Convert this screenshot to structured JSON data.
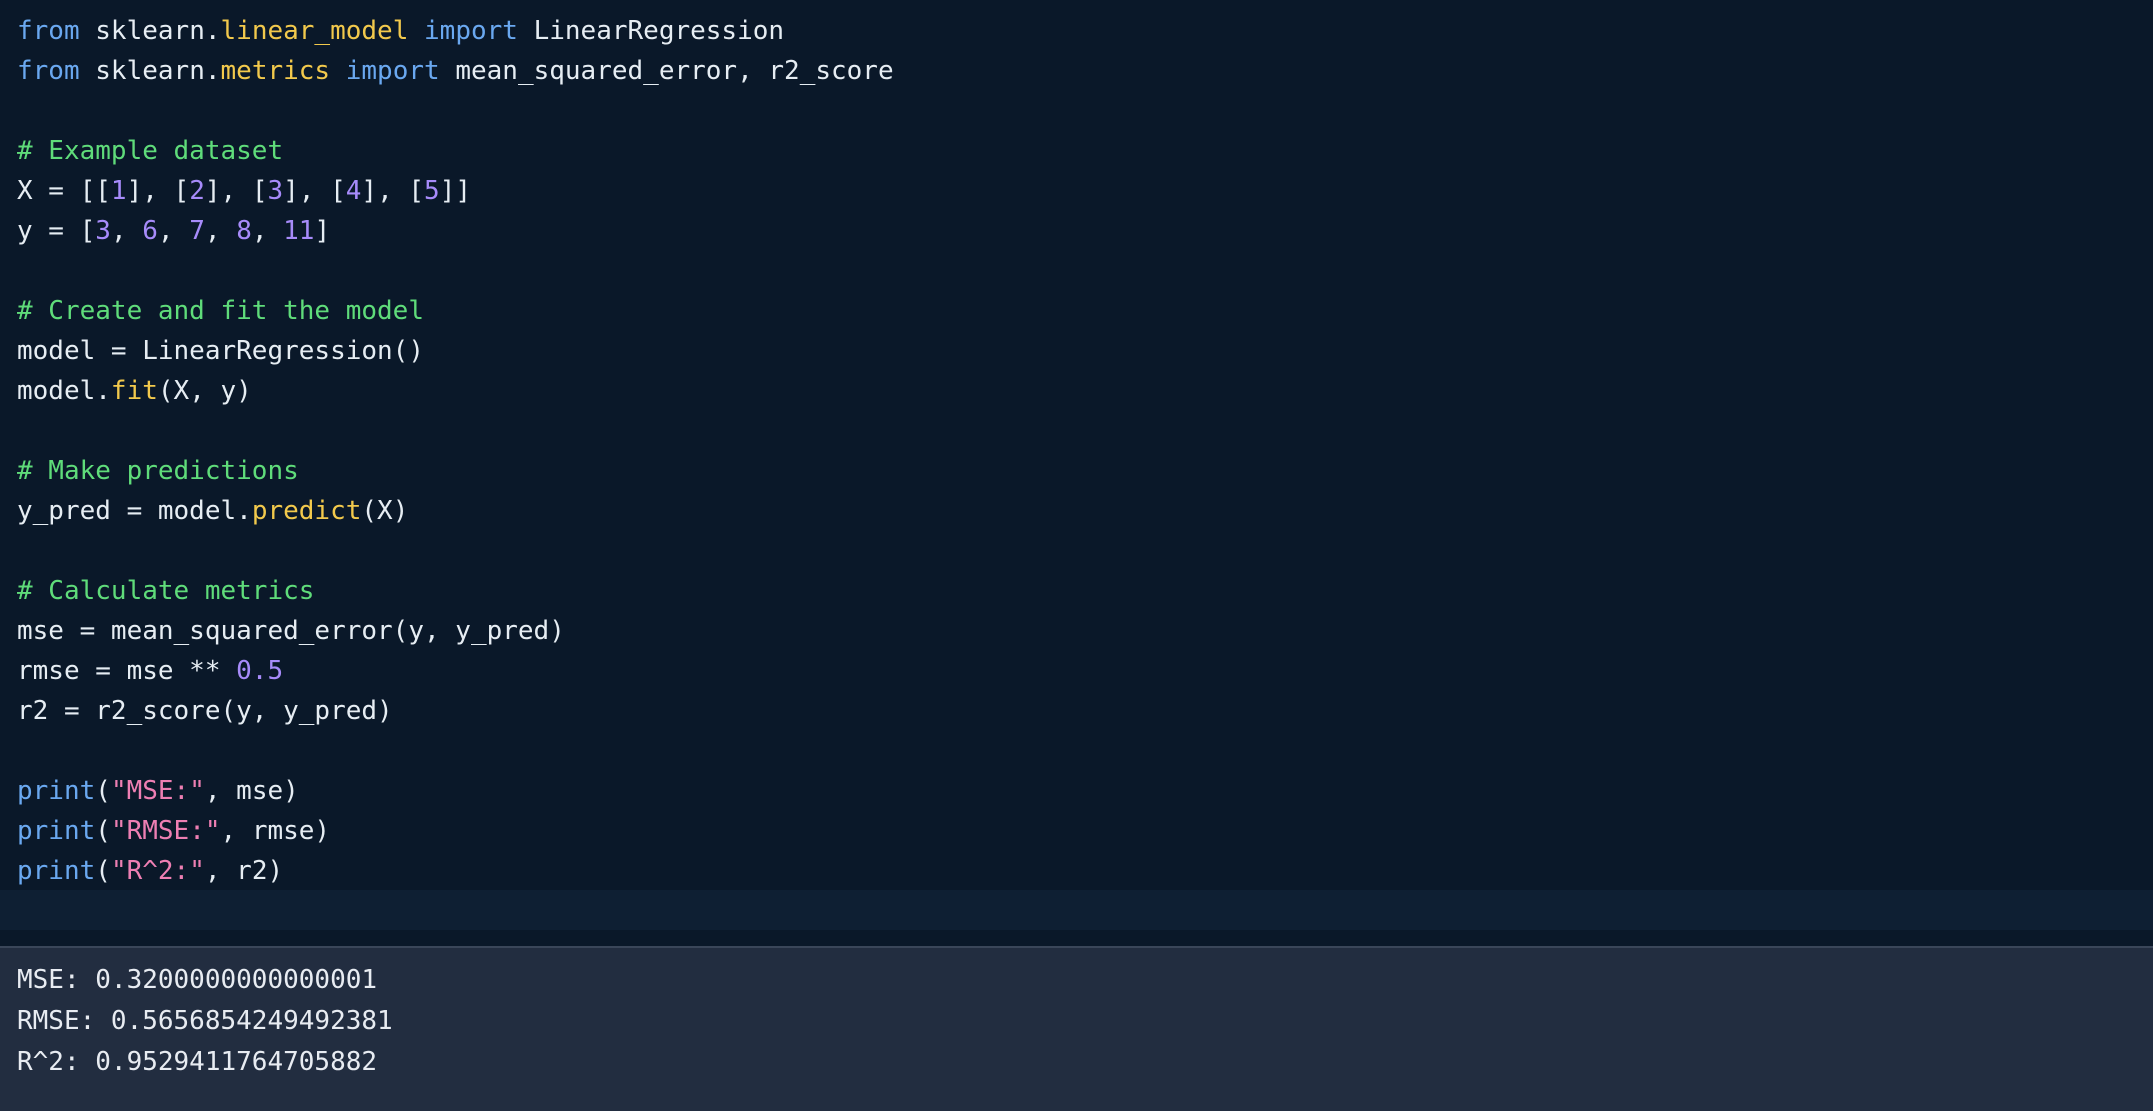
{
  "editor": {
    "lines": [
      [
        [
          "kw",
          "from"
        ],
        [
          "plain",
          " sklearn."
        ],
        [
          "fn",
          "linear_model"
        ],
        [
          "plain",
          " "
        ],
        [
          "kw",
          "import"
        ],
        [
          "plain",
          " LinearRegression"
        ]
      ],
      [
        [
          "kw",
          "from"
        ],
        [
          "plain",
          " sklearn."
        ],
        [
          "fn",
          "metrics"
        ],
        [
          "plain",
          " "
        ],
        [
          "kw",
          "import"
        ],
        [
          "plain",
          " mean_squared_error, r2_score"
        ]
      ],
      [],
      [
        [
          "cm",
          "# Example dataset"
        ]
      ],
      [
        [
          "plain",
          "X = [["
        ],
        [
          "num",
          "1"
        ],
        [
          "plain",
          "], ["
        ],
        [
          "num",
          "2"
        ],
        [
          "plain",
          "], ["
        ],
        [
          "num",
          "3"
        ],
        [
          "plain",
          "], ["
        ],
        [
          "num",
          "4"
        ],
        [
          "plain",
          "], ["
        ],
        [
          "num",
          "5"
        ],
        [
          "plain",
          "]]"
        ]
      ],
      [
        [
          "plain",
          "y = ["
        ],
        [
          "num",
          "3"
        ],
        [
          "plain",
          ", "
        ],
        [
          "num",
          "6"
        ],
        [
          "plain",
          ", "
        ],
        [
          "num",
          "7"
        ],
        [
          "plain",
          ", "
        ],
        [
          "num",
          "8"
        ],
        [
          "plain",
          ", "
        ],
        [
          "num",
          "11"
        ],
        [
          "plain",
          "]"
        ]
      ],
      [],
      [
        [
          "cm",
          "# Create and fit the model"
        ]
      ],
      [
        [
          "plain",
          "model = LinearRegression()"
        ]
      ],
      [
        [
          "plain",
          "model."
        ],
        [
          "fn",
          "fit"
        ],
        [
          "plain",
          "(X, y)"
        ]
      ],
      [],
      [
        [
          "cm",
          "# Make predictions"
        ]
      ],
      [
        [
          "plain",
          "y_pred = model."
        ],
        [
          "fn",
          "predict"
        ],
        [
          "plain",
          "(X)"
        ]
      ],
      [],
      [
        [
          "cm",
          "# Calculate metrics"
        ]
      ],
      [
        [
          "plain",
          "mse = mean_squared_error(y, y_pred)"
        ]
      ],
      [
        [
          "plain",
          "rmse = mse ** "
        ],
        [
          "num",
          "0.5"
        ]
      ],
      [
        [
          "plain",
          "r2 = r2_score(y, y_pred)"
        ]
      ],
      [],
      [
        [
          "kw",
          "print"
        ],
        [
          "plain",
          "("
        ],
        [
          "str",
          "\"MSE:\""
        ],
        [
          "plain",
          ", mse)"
        ]
      ],
      [
        [
          "kw",
          "print"
        ],
        [
          "plain",
          "("
        ],
        [
          "str",
          "\"RMSE:\""
        ],
        [
          "plain",
          ", rmse)"
        ]
      ],
      [
        [
          "kw",
          "print"
        ],
        [
          "plain",
          "("
        ],
        [
          "str",
          "\"R^2:\""
        ],
        [
          "plain",
          ", r2)"
        ]
      ],
      []
    ]
  },
  "output": {
    "lines": [
      "MSE: 0.3200000000000001",
      "RMSE: 0.5656854249492381",
      "R^2: 0.9529411764705882"
    ]
  },
  "colors": {
    "background": "#0a1829",
    "keyword": "#6aa8f0",
    "function": "#f2c94c",
    "number": "#a78bfa",
    "string": "#ee7fb3",
    "comment": "#5fdc7a",
    "text": "#e6edf3",
    "output_background": "#222d40"
  }
}
